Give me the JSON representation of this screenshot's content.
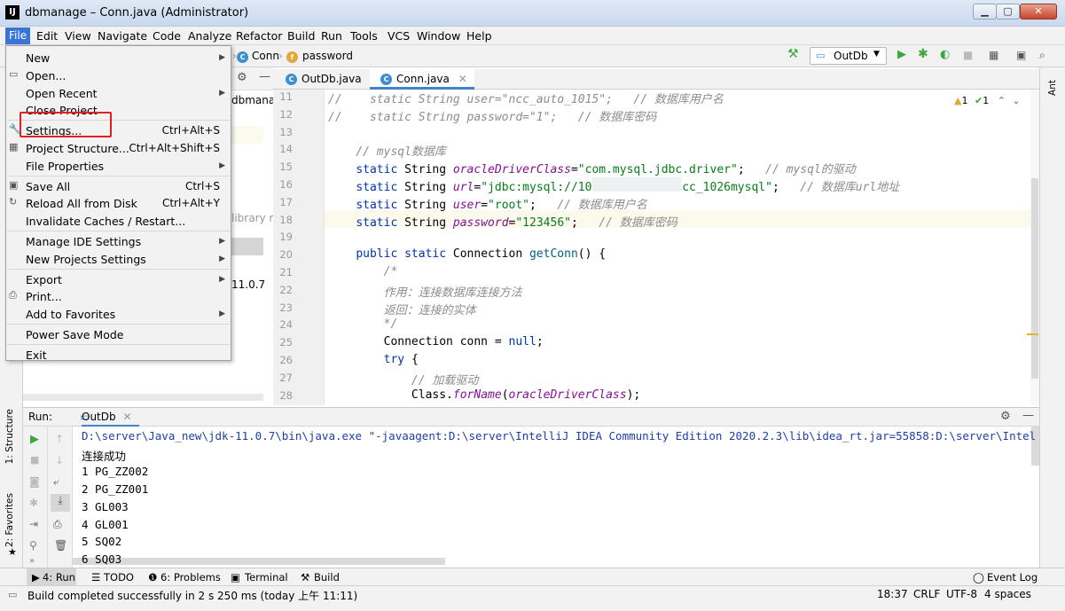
{
  "window": {
    "title": "dbmanage – Conn.java (Administrator)",
    "app_icon": "IJ"
  },
  "menubar": [
    "File",
    "Edit",
    "View",
    "Navigate",
    "Code",
    "Analyze",
    "Refactor",
    "Build",
    "Run",
    "Tools",
    "VCS",
    "Window",
    "Help"
  ],
  "nav": {
    "class": "Conn",
    "field": "password",
    "run_config": "OutDb"
  },
  "project_fragments": [
    "dbmanag",
    "library ro",
    "11.0.7"
  ],
  "editor": {
    "tabs": [
      "OutDb.java",
      "Conn.java"
    ],
    "inspections": {
      "warnings": "1",
      "ok": "1"
    },
    "line_numbers": [
      "11",
      "12",
      "13",
      "14",
      "15",
      "16",
      "17",
      "18",
      "19",
      "20",
      "21",
      "22",
      "23",
      "24",
      "25",
      "26",
      "27",
      "28"
    ],
    "lines": [
      [
        {
          "t": "//    static String user=\"ncc_auto_1015\";   // 数据库用户名",
          "c": "cmt"
        }
      ],
      [
        {
          "t": "//    static String password=\"1\";   // 数据库密码",
          "c": "cmt"
        }
      ],
      [],
      [
        {
          "t": "    // mysql数据库",
          "c": "cmt"
        }
      ],
      [
        {
          "t": "    "
        },
        {
          "t": "static ",
          "c": "kw"
        },
        {
          "t": "String "
        },
        {
          "t": "oracleDriverClass",
          "c": "fld"
        },
        {
          "t": "="
        },
        {
          "t": "\"com.mysql.jdbc.driver\"",
          "c": "str"
        },
        {
          "t": ";   "
        },
        {
          "t": "// mysql的驱动",
          "c": "cmt"
        }
      ],
      [
        {
          "t": "    "
        },
        {
          "t": "static ",
          "c": "kw"
        },
        {
          "t": "String "
        },
        {
          "t": "url",
          "c": "fld"
        },
        {
          "t": "="
        },
        {
          "t": "\"jdbc:mysql://10.          'ncc_1026mysql\"",
          "c": "str"
        },
        {
          "t": ";   "
        },
        {
          "t": "// 数据库url地址",
          "c": "cmt"
        }
      ],
      [
        {
          "t": "    "
        },
        {
          "t": "static ",
          "c": "kw"
        },
        {
          "t": "String "
        },
        {
          "t": "user",
          "c": "fld"
        },
        {
          "t": "="
        },
        {
          "t": "\"root\"",
          "c": "str"
        },
        {
          "t": ";   "
        },
        {
          "t": "// 数据库用户名",
          "c": "cmt"
        }
      ],
      [
        {
          "t": "    "
        },
        {
          "t": "static ",
          "c": "kw"
        },
        {
          "t": "String "
        },
        {
          "t": "password",
          "c": "fld"
        },
        {
          "t": "="
        },
        {
          "t": "\"123456\"",
          "c": "str"
        },
        {
          "t": ";   "
        },
        {
          "t": "// 数据库密码",
          "c": "cmt"
        }
      ],
      [],
      [
        {
          "t": "    "
        },
        {
          "t": "public static ",
          "c": "kw"
        },
        {
          "t": "Connection "
        },
        {
          "t": "getConn",
          "c": "fn"
        },
        {
          "t": "() {"
        }
      ],
      [
        {
          "t": "        /*",
          "c": "cmt"
        }
      ],
      [
        {
          "t": "        作用：连接数据库连接方法",
          "c": "cmt"
        }
      ],
      [
        {
          "t": "        返回：连接的实体",
          "c": "cmt"
        }
      ],
      [
        {
          "t": "        */",
          "c": "cmt"
        }
      ],
      [
        {
          "t": "        Connection conn = "
        },
        {
          "t": "null",
          "c": "kw"
        },
        {
          "t": ";"
        }
      ],
      [
        {
          "t": "        "
        },
        {
          "t": "try ",
          "c": "kw"
        },
        {
          "t": "{"
        }
      ],
      [
        {
          "t": "            // 加载驱动",
          "c": "cmt"
        }
      ],
      [
        {
          "t": "            Class."
        },
        {
          "t": "forName",
          "c": "fld"
        },
        {
          "t": "("
        },
        {
          "t": "oracleDriverClass",
          "c": "fld"
        },
        {
          "t": ");"
        }
      ]
    ]
  },
  "file_menu": {
    "items": [
      {
        "label": "New",
        "arrow": true
      },
      {
        "label": "Open...",
        "icon": "folder-icon"
      },
      {
        "label": "Open Recent",
        "arrow": true
      },
      {
        "label": "Close Project"
      },
      {
        "sep": true
      },
      {
        "label": "Settings...",
        "shortcut": "Ctrl+Alt+S",
        "icon": "wrench-icon"
      },
      {
        "label": "Project Structure...",
        "shortcut": "Ctrl+Alt+Shift+S",
        "icon": "structure-icon"
      },
      {
        "label": "File Properties",
        "arrow": true
      },
      {
        "sep": true
      },
      {
        "label": "Save All",
        "shortcut": "Ctrl+S",
        "icon": "save-icon"
      },
      {
        "label": "Reload All from Disk",
        "shortcut": "Ctrl+Alt+Y",
        "icon": "reload-icon"
      },
      {
        "label": "Invalidate Caches / Restart..."
      },
      {
        "sep": true
      },
      {
        "label": "Manage IDE Settings",
        "arrow": true
      },
      {
        "label": "New Projects Settings",
        "arrow": true
      },
      {
        "sep": true
      },
      {
        "label": "Export",
        "arrow": true
      },
      {
        "label": "Print...",
        "icon": "print-icon"
      },
      {
        "label": "Add to Favorites",
        "arrow": true
      },
      {
        "sep": true
      },
      {
        "label": "Power Save Mode"
      },
      {
        "sep": true
      },
      {
        "label": "Exit"
      }
    ]
  },
  "run_panel": {
    "label": "Run:",
    "tab": "OutDb",
    "console": [
      "D:\\server\\Java_new\\jdk-11.0.7\\bin\\java.exe \"-javaagent:D:\\server\\IntelliJ IDEA Community Edition 2020.2.3\\lib\\idea_rt.jar=55858:D:\\server\\Intel",
      "连接成功",
      "1 PG_ZZ002",
      "2 PG_ZZ001",
      "3 GL003",
      "4 GL001",
      "5 SQ02",
      "6 SQ03"
    ]
  },
  "side_tabs": {
    "structure": "1: Structure",
    "favorites": "2: Favorites",
    "ant": "Ant"
  },
  "bottom_tabs": {
    "run": "4: Run",
    "todo": "TODO",
    "problems": "6: Problems",
    "terminal": "Terminal",
    "build": "Build",
    "event_log": "Event Log"
  },
  "status": {
    "message": "Build completed successfully in 2 s 250 ms (today 上午 11:11)",
    "position": "18:37",
    "line_sep": "CRLF",
    "encoding": "UTF-8",
    "indent": "4 spaces"
  },
  "colors": {
    "accent": "#3875d7",
    "highlight": "#e02020",
    "run_green": "#3da73d"
  }
}
